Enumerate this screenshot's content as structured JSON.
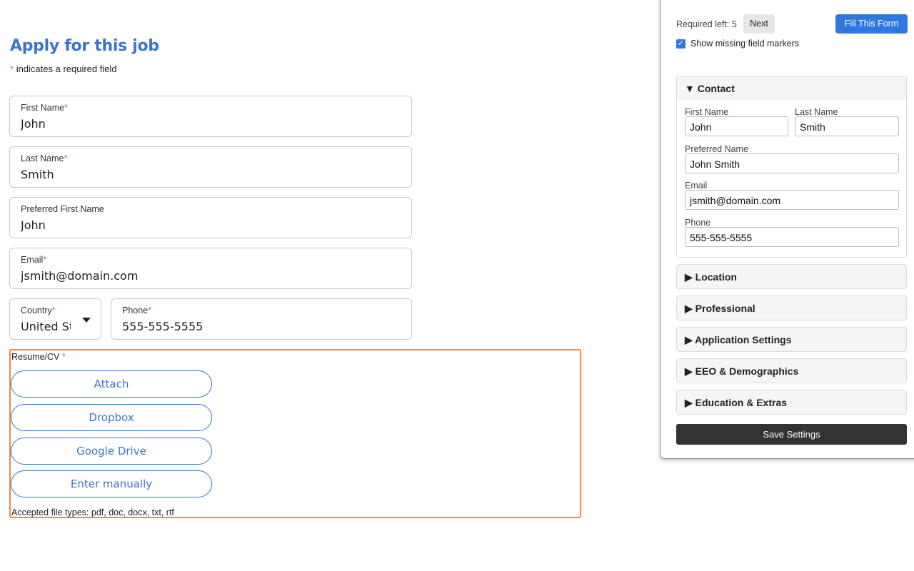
{
  "form": {
    "title": "Apply for this job",
    "required_marker": "*",
    "required_note": "indicates a required field",
    "fields": {
      "first_name": {
        "label": "First Name",
        "value": "John"
      },
      "last_name": {
        "label": "Last Name",
        "value": "Smith"
      },
      "preferred_first_name": {
        "label": "Preferred First Name",
        "value": "John"
      },
      "email": {
        "label": "Email",
        "value": "jsmith@domain.com"
      },
      "country": {
        "label": "Country",
        "value": "United St"
      },
      "phone": {
        "label": "Phone",
        "value": "555-555-5555"
      }
    },
    "resume": {
      "label": "Resume/CV",
      "buttons": {
        "attach": "Attach",
        "dropbox": "Dropbox",
        "google_drive": "Google Drive",
        "enter_manually": "Enter manually"
      },
      "accepted_types": "Accepted file types: pdf, doc, docx, txt, rtf"
    }
  },
  "panel": {
    "required_left": "Required left: 5",
    "next_label": "Next",
    "fill_label": "Fill This Form",
    "show_markers_label": "Show missing field markers",
    "show_markers_checked": true,
    "contact": {
      "header": "▼ Contact",
      "first_name_label": "First Name",
      "first_name_value": "John",
      "last_name_label": "Last Name",
      "last_name_value": "Smith",
      "preferred_name_label": "Preferred Name",
      "preferred_name_value": "John Smith",
      "email_label": "Email",
      "email_value": "jsmith@domain.com",
      "phone_label": "Phone",
      "phone_value": "555-555-5555"
    },
    "sections": {
      "location": "▶ Location",
      "professional": "▶ Professional",
      "application_settings": "▶ Application Settings",
      "eeo": "▶ EEO & Demographics",
      "education": "▶ Education & Extras"
    },
    "save_label": "Save Settings"
  },
  "colors": {
    "accent_blue": "#3b74c9",
    "required_orange": "#e06a2a",
    "highlight_border": "#f08a3c",
    "panel_button_blue": "#2f77e1"
  }
}
